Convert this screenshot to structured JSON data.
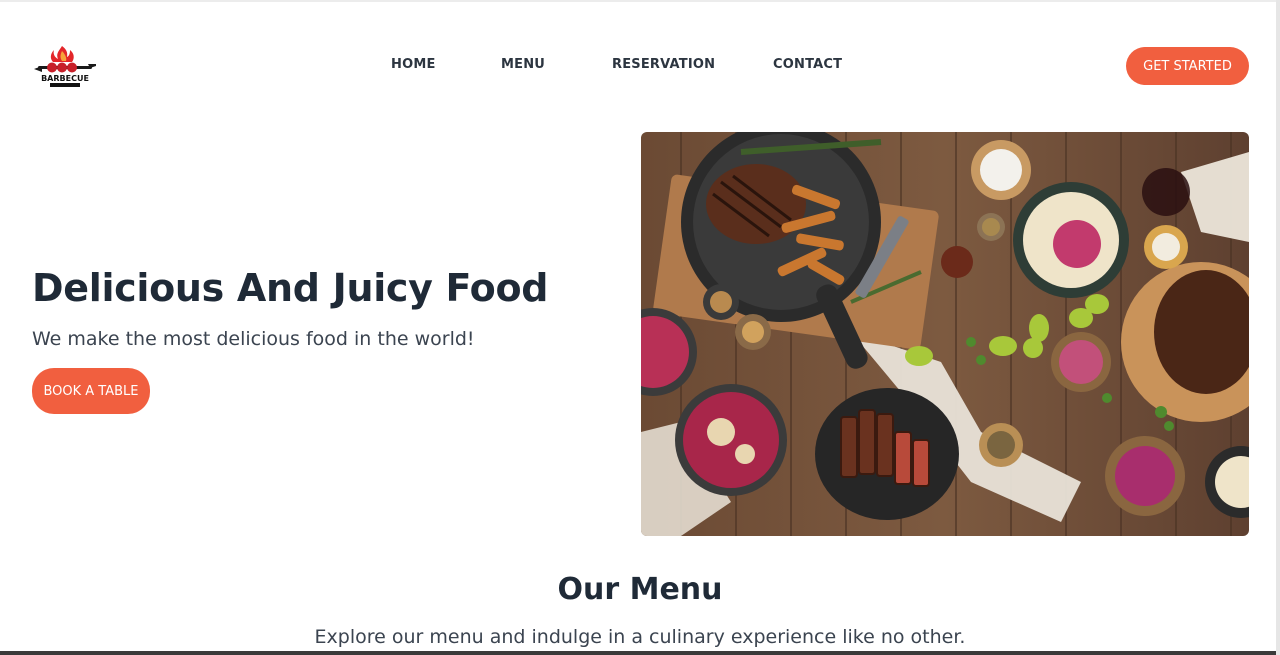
{
  "header": {
    "logo_text": "BARBECUE",
    "nav": [
      "HOME",
      "MENU",
      "RESERVATION",
      "CONTACT"
    ],
    "cta_label": "GET STARTED"
  },
  "hero": {
    "title": "Delicious And Juicy Food",
    "subtitle": "We make the most delicious food in the world!",
    "button_label": "BOOK A TABLE",
    "image_icon": "food-photo"
  },
  "menu_section": {
    "title": "Our Menu",
    "subtitle": "Explore our menu and indulge in a culinary experience like no other."
  },
  "colors": {
    "accent": "#f15f3f",
    "heading": "#1f2a37",
    "body_text": "#3b4450"
  }
}
